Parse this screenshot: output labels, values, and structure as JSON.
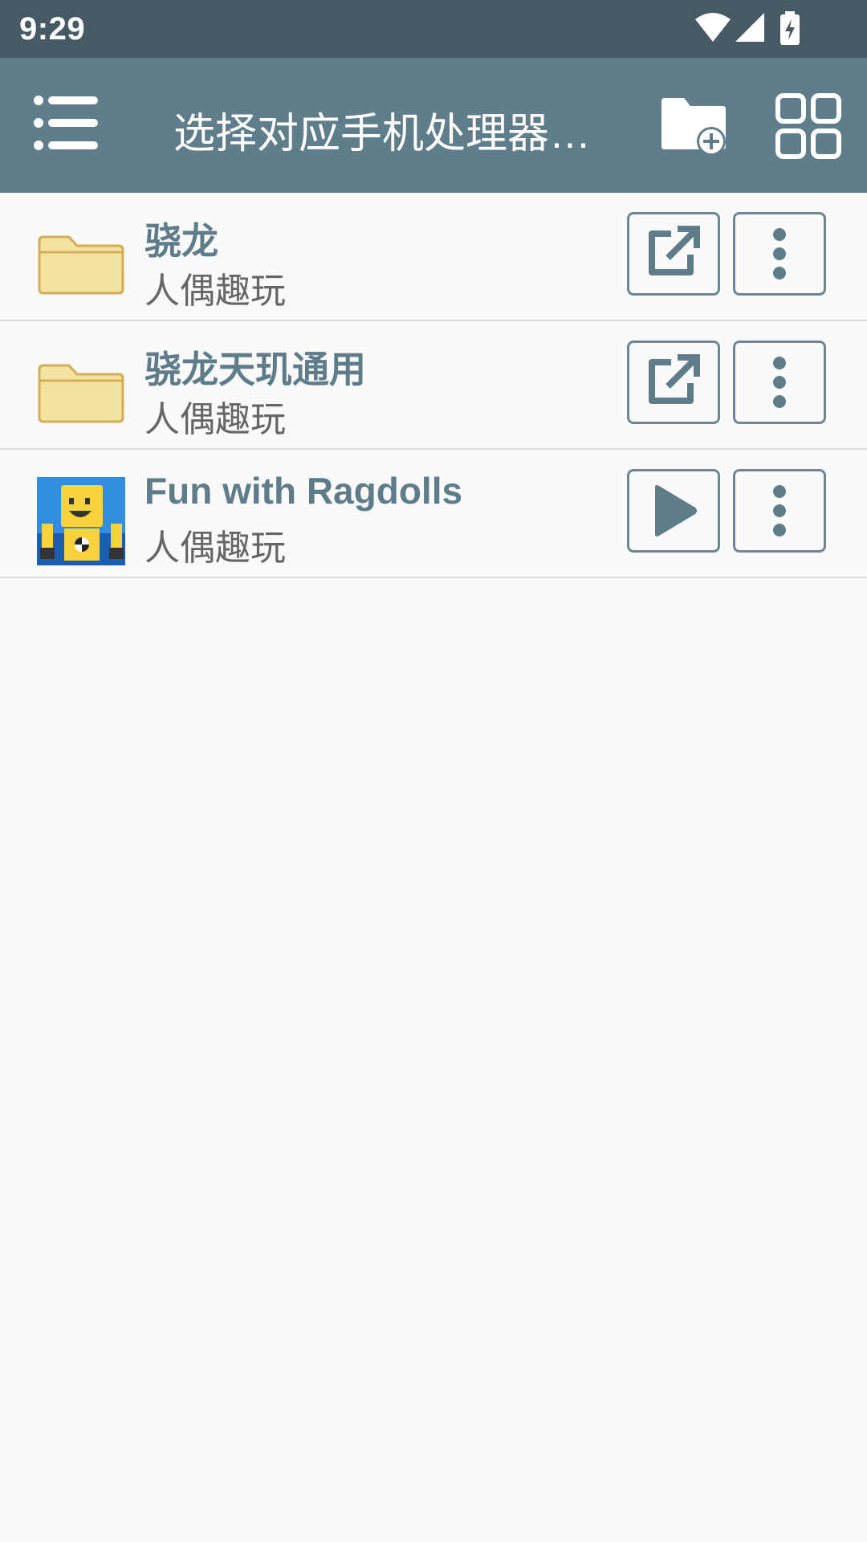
{
  "status_bar": {
    "time": "9:29",
    "icons": [
      "wifi-icon",
      "cellular-signal-icon",
      "battery-charging-icon"
    ]
  },
  "app_bar": {
    "title": "选择对应手机处理器…",
    "menu_icon": "menu-icon",
    "new_folder_icon": "new-folder-icon",
    "grid_view_icon": "grid-view-icon"
  },
  "items": [
    {
      "name": "骁龙",
      "subtitle": "人偶趣玩",
      "kind": "folder",
      "primary_icon": "open-external-icon",
      "more_icon": "more-vertical-icon"
    },
    {
      "name": "骁龙天玑通用",
      "subtitle": "人偶趣玩",
      "kind": "folder",
      "primary_icon": "open-external-icon",
      "more_icon": "more-vertical-icon"
    },
    {
      "name": "Fun with Ragdolls",
      "subtitle": "人偶趣玩",
      "kind": "app",
      "primary_icon": "play-icon",
      "more_icon": "more-vertical-icon"
    }
  ],
  "colors": {
    "status_bar": "#455a64",
    "app_bar": "#607d8b",
    "accent": "#5f7c8b",
    "folder_fill": "#f3e3a1",
    "folder_stroke": "#d4ae55"
  }
}
